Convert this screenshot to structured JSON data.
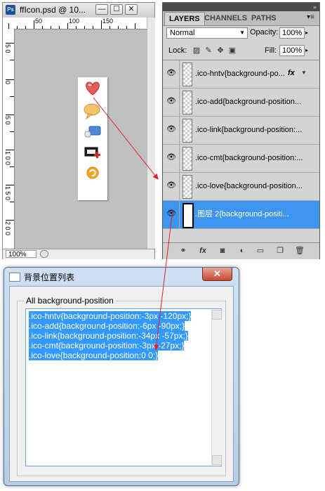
{
  "document_window": {
    "app_icon": "photoshop-icon",
    "title": "ffIcon.psd @ 10...",
    "minimize": "—",
    "maximize": "☐",
    "close": "✕",
    "ruler_top_labels": [
      "50",
      "100",
      "150"
    ],
    "ruler_left_labels": [
      "5 0",
      "0",
      "5 0",
      "1 0 0",
      "1 5 0",
      "2 0 0"
    ],
    "zoom": "100%",
    "strip_icons": [
      "heart-icon",
      "speech-bubble-icon",
      "chat-link-icon",
      "film-add-icon",
      "refresh-icon"
    ]
  },
  "layers_panel": {
    "tabs": [
      "LAYERS",
      "CHANNELS",
      "PATHS"
    ],
    "blend_mode": "Normal",
    "opacity_label": "Opacity:",
    "opacity_value": "100%",
    "lock_label": "Lock:",
    "fill_label": "Fill:",
    "fill_value": "100%",
    "fx_badge": "fx",
    "layers": [
      {
        "name": ".ico-hntv{background-po...",
        "selected": false
      },
      {
        "name": ".ico-add{background-position...",
        "selected": false
      },
      {
        "name": ".ico-link{background-position:...",
        "selected": false
      },
      {
        "name": ".ico-cmt{background-position:...",
        "selected": false
      },
      {
        "name": ".ico-love{background-position...",
        "selected": false
      },
      {
        "name": ".图层 2{background-positi...",
        "selected": true
      }
    ],
    "bottom_icons": [
      "link-icon",
      "fx-icon",
      "mask-icon",
      "adjustment-icon",
      "folder-icon",
      "new-layer-icon",
      "trash-icon"
    ]
  },
  "dialog": {
    "title": "背景位置列表",
    "close": "✕",
    "group_label": "All background-position",
    "lines": [
      ".ico-hntv{background-position:-3px -120px;}",
      ".ico-add{background-position:-6px -90px;}",
      ".ico-link{background-position:-34px -57px;}",
      ".ico-cmt{background-position:-3px -27px;}",
      ".ico-love{background-position:0 0;}"
    ]
  },
  "colors": {
    "selection": "#3d95ef",
    "text_highlight": "#3399ff",
    "arrow": "#e02020",
    "canvas_bg": "#c0c0c0",
    "dialog_frame": "#b7cde6"
  }
}
